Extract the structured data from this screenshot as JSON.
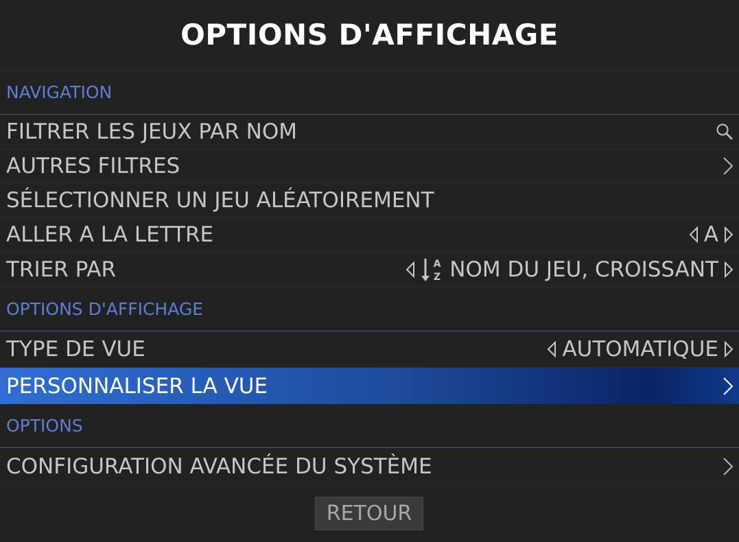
{
  "title": "OPTIONS D'AFFICHAGE",
  "sections": {
    "navigation": "NAVIGATION",
    "display": "OPTIONS D'AFFICHAGE",
    "options": "OPTIONS"
  },
  "items": {
    "filter_name": {
      "label": "FILTRER LES JEUX PAR NOM",
      "icon": "search-icon"
    },
    "other_filters": {
      "label": "AUTRES FILTRES",
      "icon": "chevron-right-icon"
    },
    "random_game": {
      "label": "SÉLECTIONNER UN JEU ALÉATOIREMENT"
    },
    "go_to_letter": {
      "label": "ALLER A LA LETTRE",
      "value": "A"
    },
    "sort_by": {
      "label": "TRIER PAR",
      "value": "NOM DU JEU, CROISSANT",
      "sort_icon": "sort-alpha-asc-icon",
      "sort_letters": [
        "A",
        "Z"
      ]
    },
    "view_type": {
      "label": "TYPE DE VUE",
      "value": "AUTOMATIQUE"
    },
    "customize_view": {
      "label": "PERSONNALISER LA VUE",
      "selected": true
    },
    "advanced_config": {
      "label": "CONFIGURATION AVANCÉE DU SYSTÈME"
    }
  },
  "back_button": "RETOUR",
  "colors": {
    "background": "#222222",
    "section_header": "#5b7fd4",
    "item_text": "#c6c6c6",
    "selected_text": "#ffffff",
    "selected_gradient_start": "#2f6fd6",
    "selected_gradient_end": "#0a2466"
  }
}
